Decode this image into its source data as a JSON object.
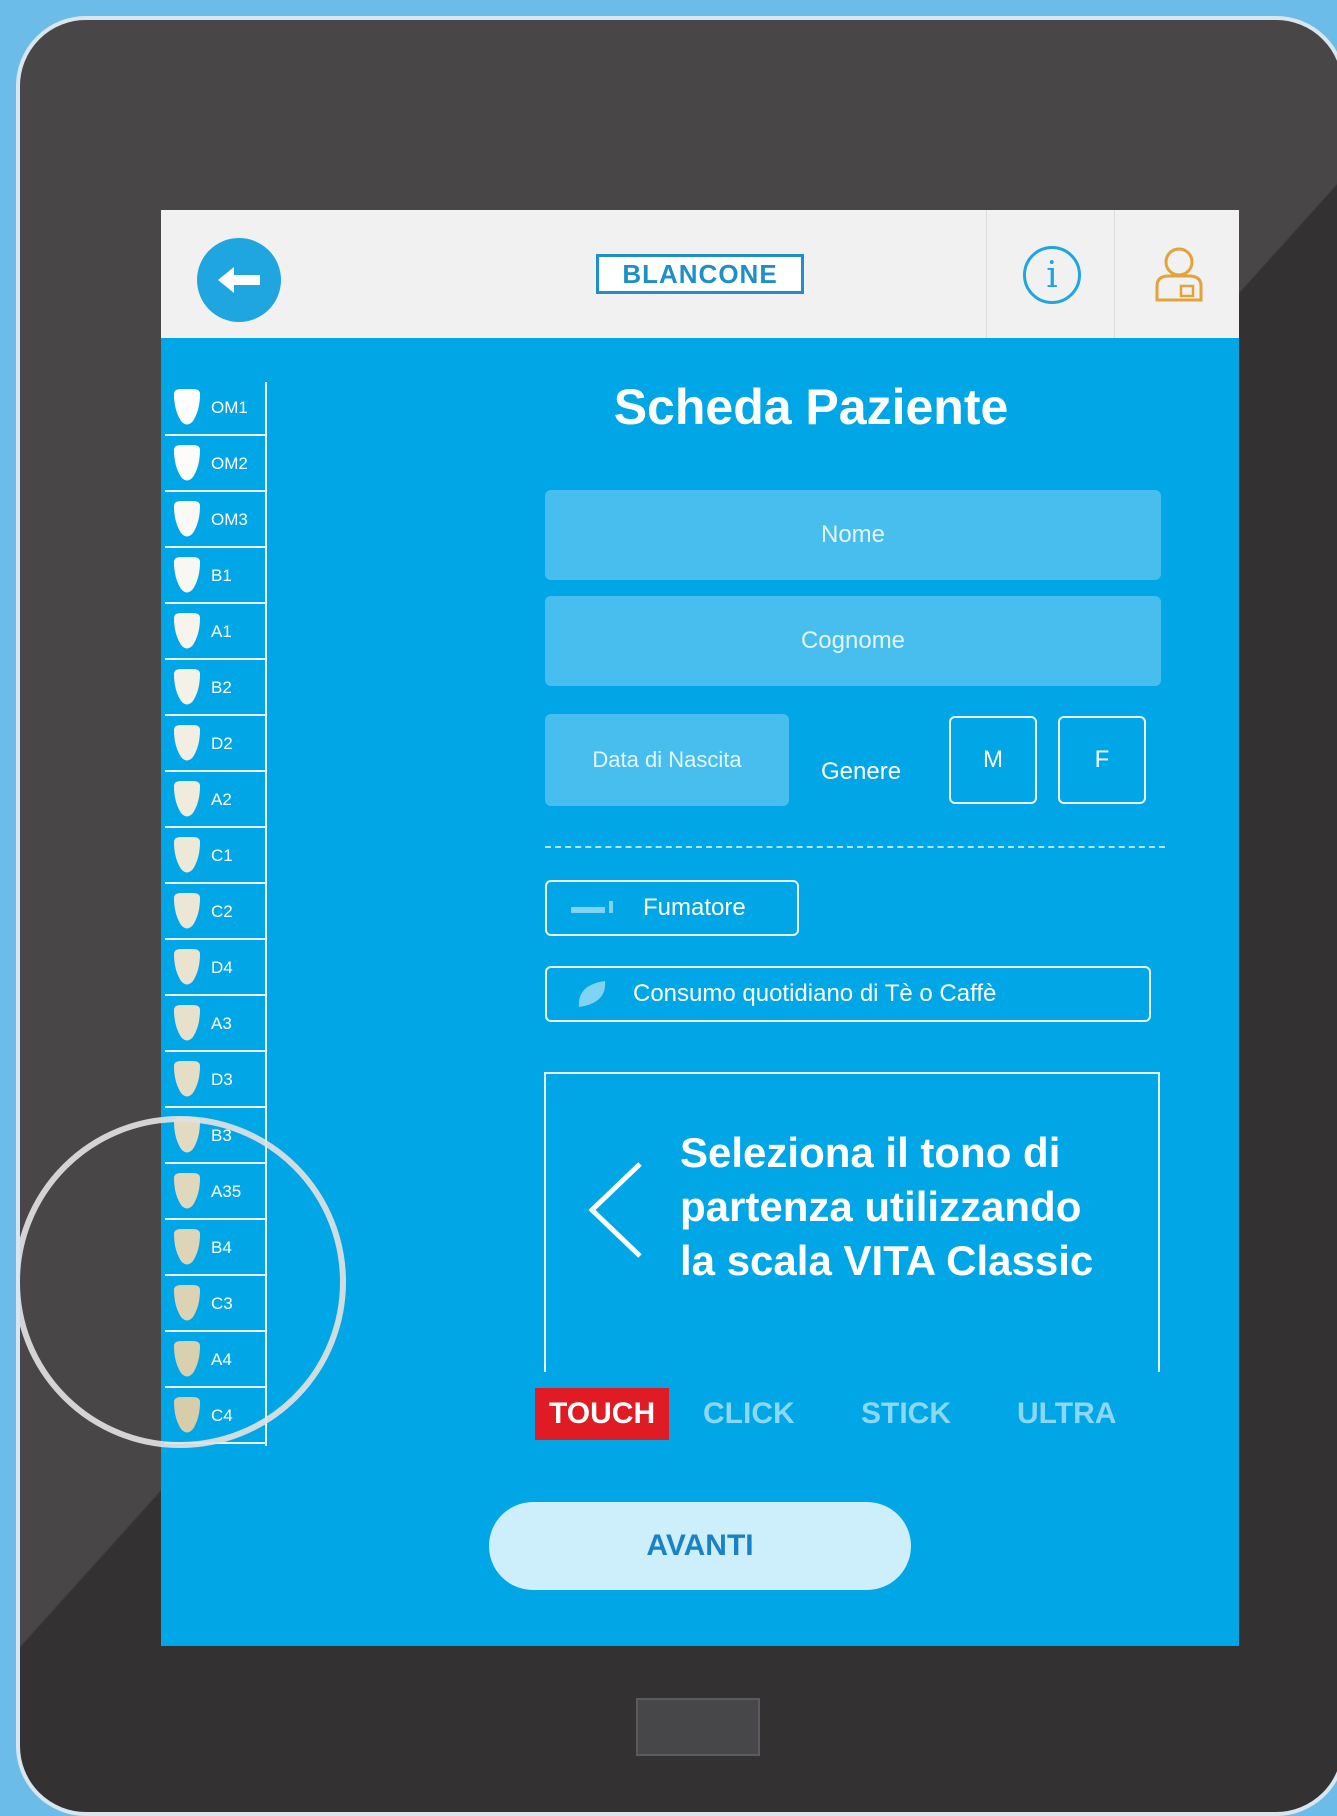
{
  "header": {
    "brand": "BLANCONE",
    "info_icon": "info-icon",
    "user_icon": "user-lock-icon",
    "back_icon": "arrow-left-icon"
  },
  "shade_guide": {
    "items": [
      "OM1",
      "OM2",
      "OM3",
      "B1",
      "A1",
      "B2",
      "D2",
      "A2",
      "C1",
      "C2",
      "D4",
      "A3",
      "D3",
      "B3",
      "A35",
      "B4",
      "C3",
      "A4",
      "C4"
    ]
  },
  "form": {
    "title": "Scheda Paziente",
    "nome_placeholder": "Nome",
    "cognome_placeholder": "Cognome",
    "birth_placeholder": "Data di Nascita",
    "gender_label": "Genere",
    "gender_m": "M",
    "gender_f": "F",
    "smoker_label": "Fumatore",
    "tea_label": "Consumo quotidiano di Tè o Caffè"
  },
  "shade_panel": {
    "line1": "Seleziona il tono di",
    "line2": "partenza utilizzando",
    "line3": "la scala VITA Classic"
  },
  "products": {
    "tabs": [
      "TOUCH",
      "CLICK",
      "STICK",
      "ULTRA"
    ],
    "active": "TOUCH"
  },
  "actions": {
    "next_label": "AVANTI"
  },
  "colors": {
    "screen_bg": "#00a6e6",
    "accent_red": "#e01b24",
    "frame": "#333132",
    "user_icon": "#e2a33a"
  }
}
